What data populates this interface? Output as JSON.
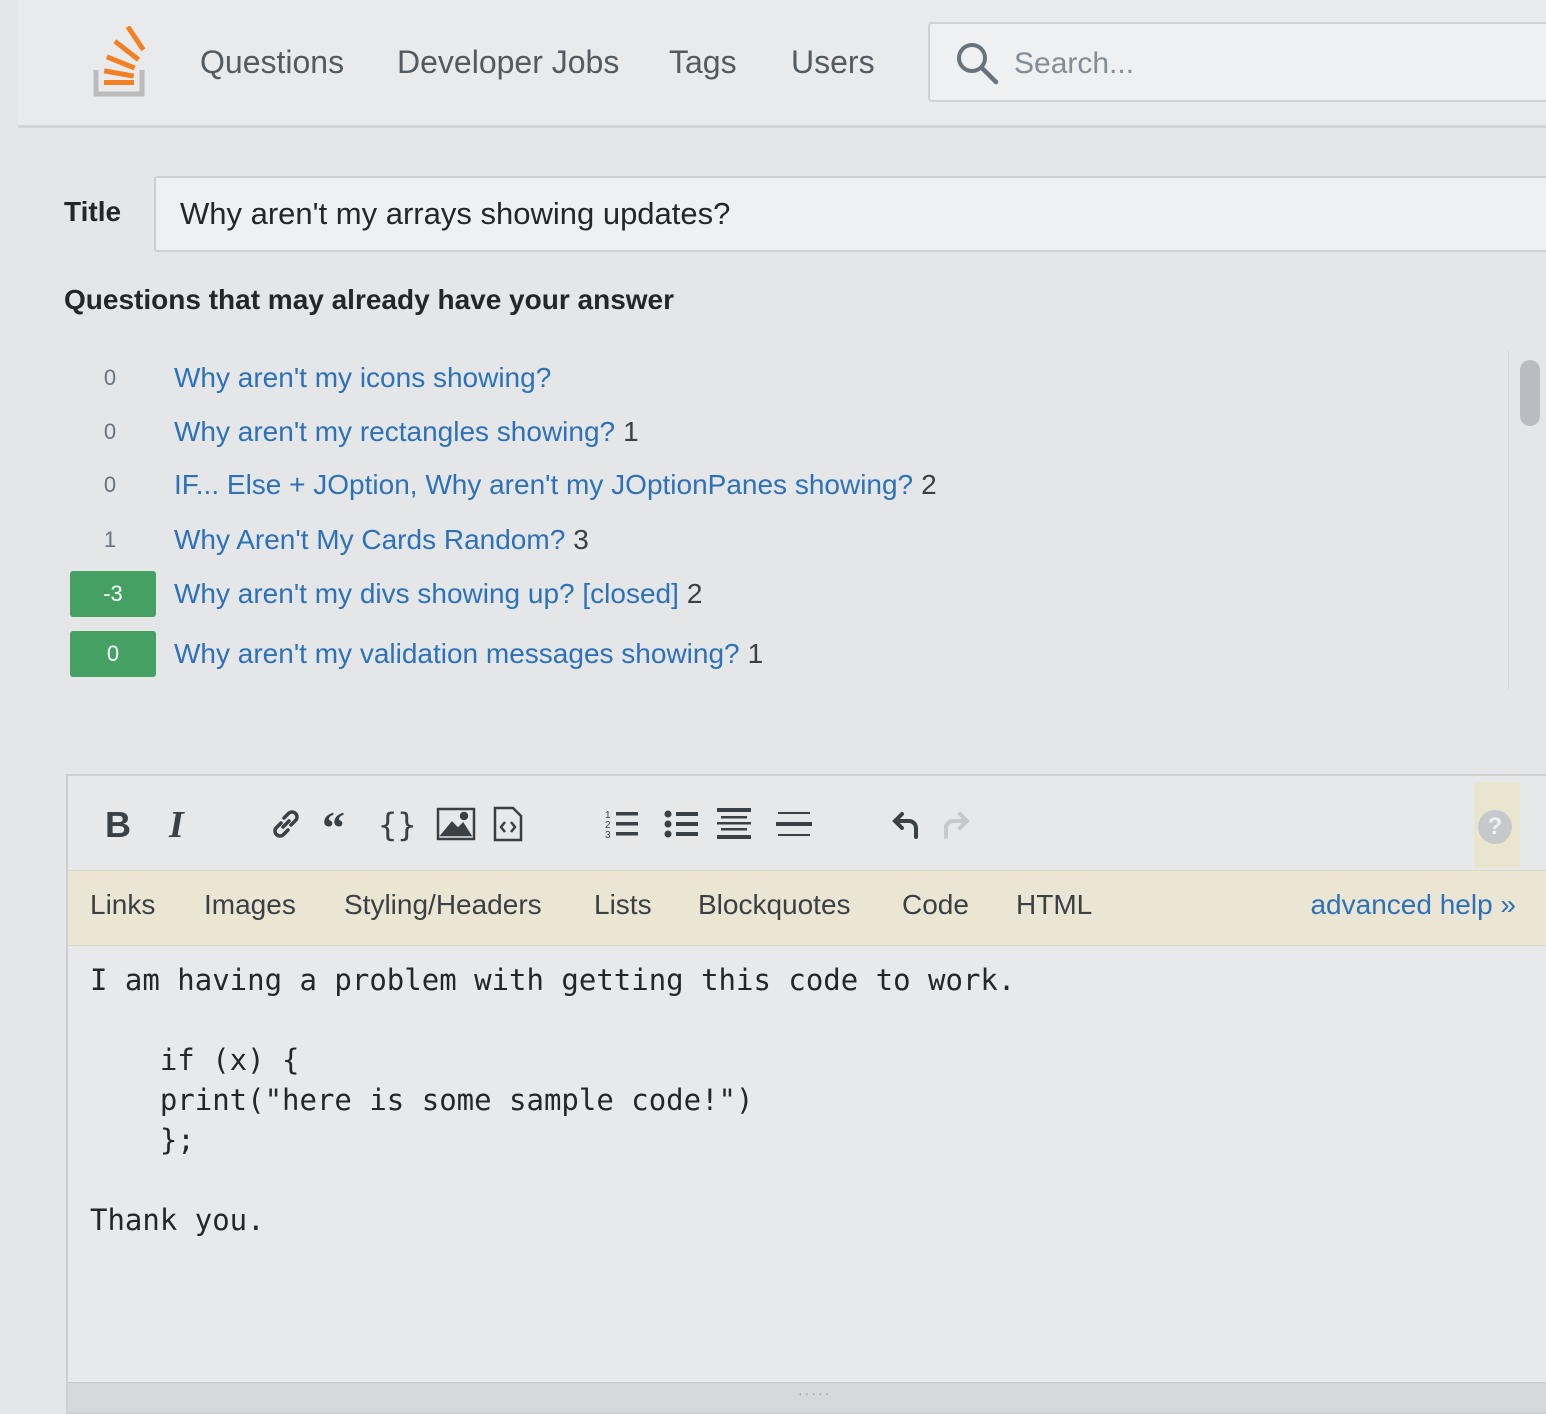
{
  "nav": {
    "items": [
      {
        "label": "Questions"
      },
      {
        "label": "Developer Jobs"
      },
      {
        "label": "Tags"
      },
      {
        "label": "Users"
      }
    ],
    "search_placeholder": "Search...",
    "brand_color": "#f48024"
  },
  "question": {
    "title_label": "Title",
    "title_value": "Why aren't my arrays showing updates?"
  },
  "similar": {
    "heading": "Questions that may already have your answer",
    "items": [
      {
        "votes": "0",
        "accepted": false,
        "title": "Why aren't my icons showing?",
        "answers": ""
      },
      {
        "votes": "0",
        "accepted": false,
        "title": "Why aren't my rectangles showing?",
        "answers": "1"
      },
      {
        "votes": "0",
        "accepted": false,
        "title": "IF... Else + JOption, Why aren't my JOptionPanes showing?",
        "answers": "2"
      },
      {
        "votes": "1",
        "accepted": false,
        "title": "Why Aren't My Cards Random?",
        "answers": "3"
      },
      {
        "votes": "-3",
        "accepted": true,
        "title": "Why aren't my divs showing up? [closed]",
        "answers": "2"
      },
      {
        "votes": "0",
        "accepted": true,
        "title": "Why aren't my validation messages showing?",
        "answers": "1"
      }
    ],
    "accepted_color": "#45a163",
    "link_color": "#2d72b8"
  },
  "toolbar": {
    "buttons": [
      "bold-icon",
      "italic-icon",
      "link-icon",
      "blockquote-icon",
      "code-icon",
      "image-icon",
      "snippet-icon",
      "ordered-list-icon",
      "bulleted-list-icon",
      "heading-icon",
      "horizontal-rule-icon",
      "undo-icon",
      "redo-icon"
    ],
    "help_glyph": "?"
  },
  "helpbar": {
    "tabs": [
      "Links",
      "Images",
      "Styling/Headers",
      "Lists",
      "Blockquotes",
      "Code",
      "HTML"
    ],
    "advanced": "advanced help »"
  },
  "body": {
    "lines": [
      "I am having a problem with getting this code to work.",
      "",
      "    if (x) {",
      "    print(\"here is some sample code!\")",
      "    };",
      "",
      "Thank you."
    ]
  }
}
